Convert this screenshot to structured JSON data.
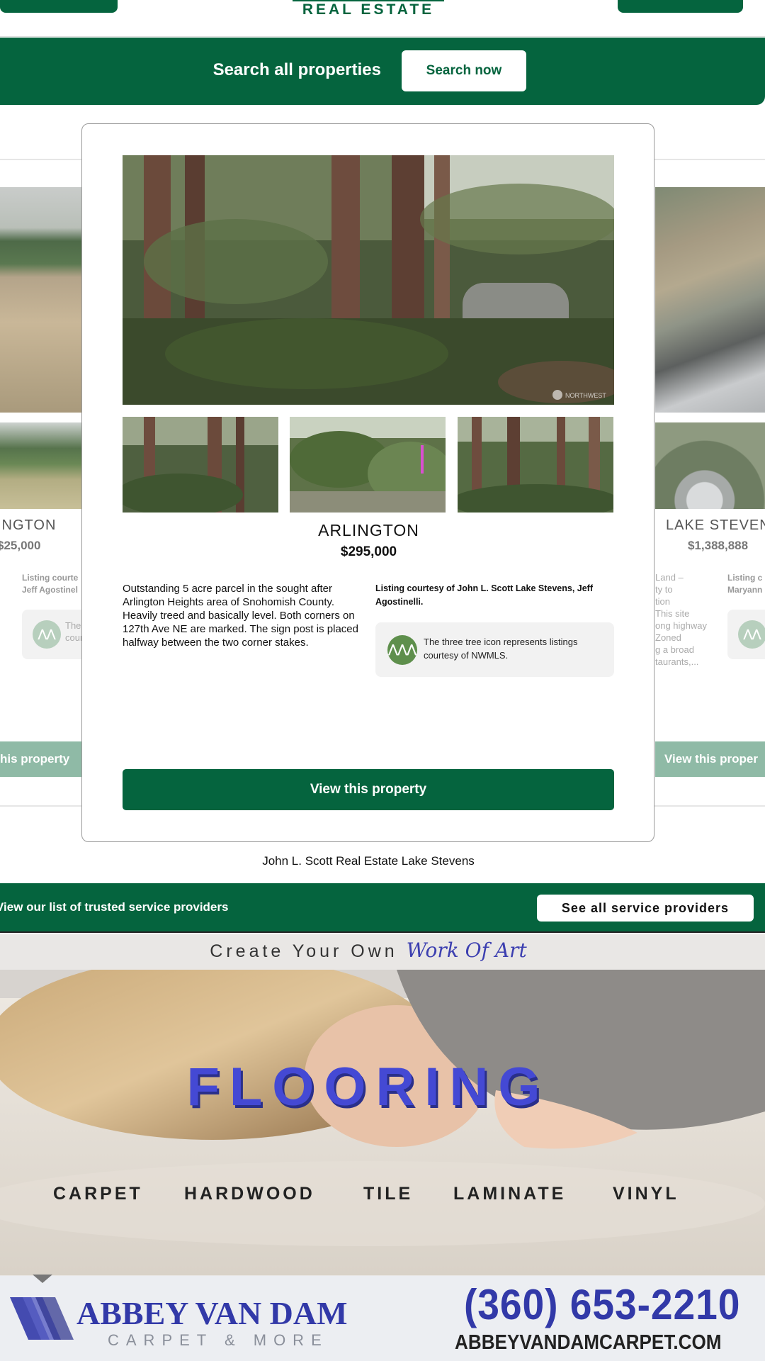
{
  "header": {
    "logo_text": "REAL ESTATE"
  },
  "search_banner": {
    "title": "Search all properties",
    "button_label": "Search now"
  },
  "carousel": {
    "left_card": {
      "city": "INGTON",
      "price": "$25,000",
      "courtesy_line1": "Listing courte",
      "courtesy_line2": "Jeff Agostinel",
      "note_line1": "The",
      "note_line2": "cour",
      "button_label": "his property"
    },
    "right_card": {
      "city": "LAKE STEVEN",
      "price": "$1,388,888",
      "desc_lines": [
        "Land –",
        "ty to",
        "tion",
        "This site",
        "ong highway",
        "Zoned",
        "g a broad",
        "taurants,..."
      ],
      "courtesy_line1": "Listing c",
      "courtesy_line2": "Maryann",
      "button_label": "View this proper"
    }
  },
  "modal": {
    "city": "ARLINGTON",
    "price": "$295,000",
    "description": "Outstanding 5 acre parcel in the sought after Arlington Heights area of Snohomish County. Heavily treed and basically level. Both corners on 127th Ave NE are marked. The sign post is placed halfway between the two corner stakes.",
    "courtesy": "Listing courtesy of John L. Scott Lake Stevens, Jeff Agostinelli.",
    "mls_note": "The three tree icon represents listings courtesy of NWMLS.",
    "mls_icon": "three-tree-icon",
    "photo_watermark": "NORTHWEST",
    "view_button": "View this property"
  },
  "office_name": "John L. Scott Real Estate Lake Stevens",
  "providers": {
    "text": "View our list of trusted service providers",
    "button_label": "See all service providers"
  },
  "ad": {
    "tagline_prefix": "Create Your Own",
    "tagline_script": "Work Of Art",
    "headline": "FLOORING",
    "categories": [
      "CARPET",
      "HARDWOOD",
      "TILE",
      "LAMINATE",
      "VINYL"
    ],
    "brand": "ABBEY VAN DAM",
    "brand_sub": "CARPET & MORE",
    "phone": "(360) 653-2210",
    "website": "ABBEYVANDAMCARPET.COM"
  },
  "colors": {
    "brand_green": "#05643e",
    "muted_green": "#8fbaa6",
    "ad_blue": "#3239a8"
  }
}
